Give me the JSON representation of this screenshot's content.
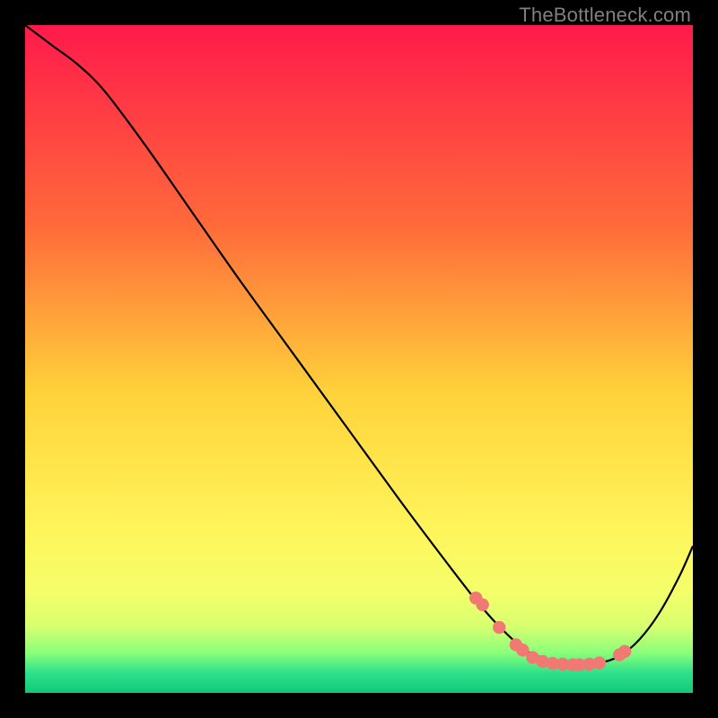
{
  "watermark": "TheBottleneck.com",
  "colors": {
    "frame": "#000000",
    "line": "#000000",
    "dot_fill": "#f07a73",
    "dot_stroke": "#f07a73",
    "watermark": "#808080",
    "gradient_stops": [
      {
        "offset": 0,
        "color": "#ff1a4b"
      },
      {
        "offset": 0.3,
        "color": "#ff6a3a"
      },
      {
        "offset": 0.55,
        "color": "#ffd23a"
      },
      {
        "offset": 0.75,
        "color": "#fff45a"
      },
      {
        "offset": 0.85,
        "color": "#f4ff6a"
      },
      {
        "offset": 0.9,
        "color": "#d8ff70"
      },
      {
        "offset": 0.94,
        "color": "#8aff7a"
      },
      {
        "offset": 0.97,
        "color": "#2fe08a"
      },
      {
        "offset": 1.0,
        "color": "#11c87a"
      }
    ]
  },
  "chart_data": {
    "type": "line",
    "title": "",
    "xlabel": "",
    "ylabel": "",
    "xlim": [
      0,
      100
    ],
    "ylim": [
      0,
      100
    ],
    "series": [
      {
        "name": "bottleneck-curve",
        "x": [
          0,
          4,
          8,
          12,
          18,
          25,
          32,
          40,
          48,
          56,
          62,
          67,
          70,
          73,
          75,
          78,
          80,
          83,
          86,
          89,
          92,
          95,
          98,
          100
        ],
        "y": [
          100,
          97,
          94,
          90,
          82,
          72,
          62,
          51,
          40,
          29,
          21,
          14.5,
          11,
          8,
          6.3,
          5,
          4.3,
          4.2,
          4.5,
          5.5,
          8,
          12,
          17.5,
          22
        ]
      }
    ],
    "dots": {
      "name": "highlight-dots",
      "x": [
        67.5,
        68.5,
        71,
        73.5,
        74.5,
        76,
        77.5,
        79,
        80.5,
        82,
        83,
        84.5,
        86,
        89,
        89.8
      ],
      "y": [
        14.2,
        13.2,
        9.8,
        7.2,
        6.4,
        5.3,
        4.7,
        4.4,
        4.3,
        4.2,
        4.2,
        4.3,
        4.5,
        5.7,
        6.2
      ]
    }
  }
}
